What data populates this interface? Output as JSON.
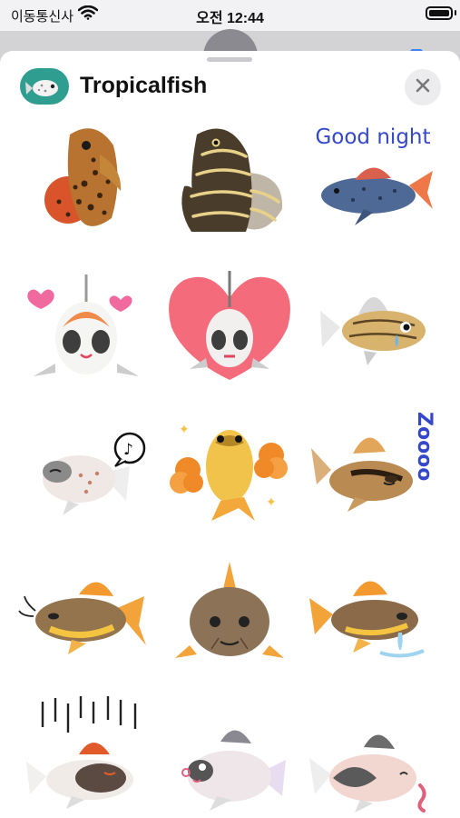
{
  "status_bar": {
    "carrier": "이동통신사",
    "time": "오전 12:44"
  },
  "sheet": {
    "app_name": "Tropicalfish",
    "app_icon": "fish-app-icon",
    "close_icon": "close-icon"
  },
  "stickers": [
    {
      "name": "brown-spotted-fish-sticker"
    },
    {
      "name": "striped-zebra-fish-sticker"
    },
    {
      "name": "good-night-pleco-sticker",
      "caption": "Good night"
    },
    {
      "name": "fish-with-hearts-sticker"
    },
    {
      "name": "fish-in-heart-sticker"
    },
    {
      "name": "crying-spotted-fish-sticker"
    },
    {
      "name": "fish-with-music-bubble-sticker"
    },
    {
      "name": "golden-fish-with-flowers-sticker"
    },
    {
      "name": "sleeping-fish-zzz-sticker",
      "caption": "Zoooo"
    },
    {
      "name": "catfish-sticker"
    },
    {
      "name": "front-facing-fish-sticker"
    },
    {
      "name": "drooling-orange-fish-sticker"
    },
    {
      "name": "rainy-gloomy-fish-sticker"
    },
    {
      "name": "grey-pink-fish-sticker"
    },
    {
      "name": "pink-fish-with-worm-sticker"
    }
  ]
}
